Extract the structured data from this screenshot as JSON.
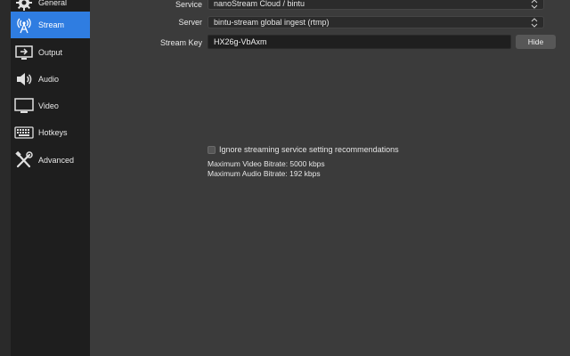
{
  "sidebar": {
    "items": [
      {
        "label": "General",
        "icon": "gear-icon"
      },
      {
        "label": "Stream",
        "icon": "antenna-icon",
        "active": true
      },
      {
        "label": "Output",
        "icon": "output-icon"
      },
      {
        "label": "Audio",
        "icon": "speaker-icon"
      },
      {
        "label": "Video",
        "icon": "monitor-icon"
      },
      {
        "label": "Hotkeys",
        "icon": "keyboard-icon"
      },
      {
        "label": "Advanced",
        "icon": "tools-icon"
      }
    ]
  },
  "form": {
    "service_label": "Service",
    "service_value": "nanoStream Cloud / bintu",
    "server_label": "Server",
    "server_value": "bintu-stream global ingest (rtmp)",
    "stream_key_label": "Stream Key",
    "stream_key_value": "HX26g-VbAxm",
    "hide_button": "Hide",
    "ignore_label": "Ignore streaming service setting recommendations",
    "ignore_checked": false,
    "max_video": "Maximum Video Bitrate: 5000 kbps",
    "max_audio": "Maximum Audio Bitrate: 192 kbps"
  },
  "colors": {
    "accent": "#2f7de1",
    "sidebar_bg": "#1e1e1e",
    "main_bg": "#3b3b3b"
  }
}
